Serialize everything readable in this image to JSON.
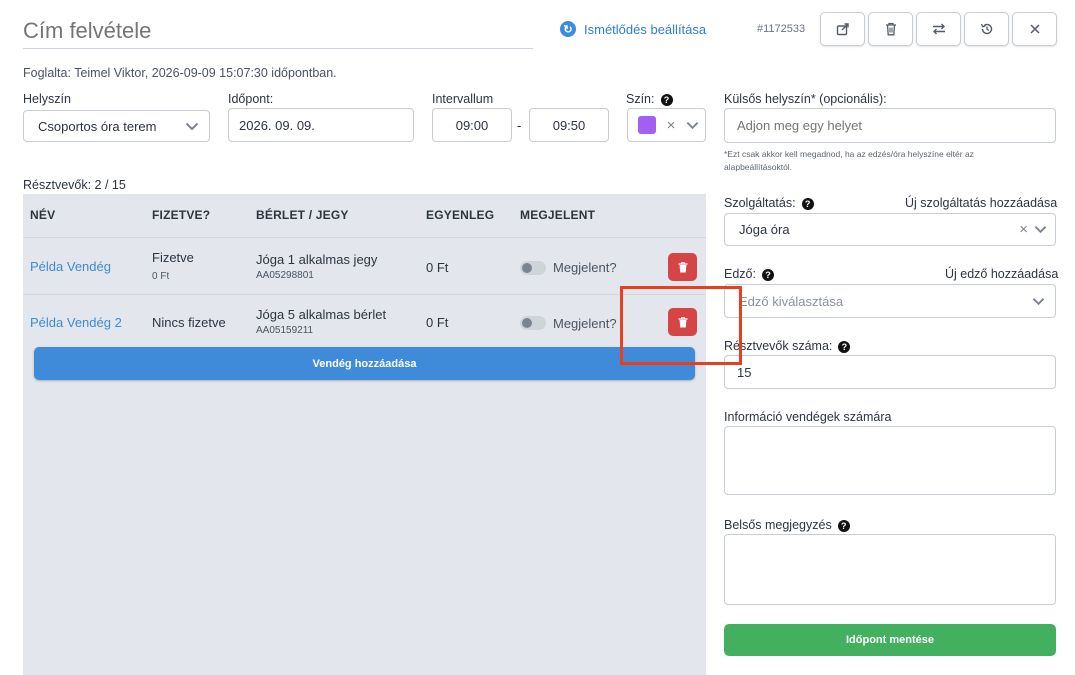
{
  "header": {
    "title_placeholder": "Cím felvétele",
    "repeat_label": "Ismétlődés beállítása",
    "booking_id": "#1172533"
  },
  "booked_by": "Foglalta: Teimel Viktor, 2026-09-09 15:07:30 időpontban.",
  "form": {
    "location_label": "Helyszín",
    "location_value": "Csoportos óra terem",
    "date_label": "Időpont:",
    "date_value": "2026. 09. 09.",
    "interval_label": "Intervallum",
    "interval_start": "09:00",
    "interval_separator": "-",
    "interval_end": "09:50",
    "color_label": "Szín:",
    "color_value": "#a55ff0"
  },
  "participants": {
    "count_label": "Résztvevők: 2 / 15",
    "headers": [
      "NÉV",
      "FIZETVE?",
      "BÉRLET / JEGY",
      "EGYENLEG",
      "MEGJELENT"
    ],
    "rows": [
      {
        "name": "Példa Vendég",
        "paid": "Fizetve",
        "paid_amount": "0 Ft",
        "pass": "Jóga 1 alkalmas jegy",
        "pass_code": "AA05298801",
        "balance": "0 Ft",
        "attended_label": "Megjelent?"
      },
      {
        "name": "Példa Vendég 2",
        "paid": "Nincs fizetve",
        "pass": "Jóga 5 alkalmas bérlet",
        "pass_code": "AA05159211",
        "balance": "0 Ft",
        "attended_label": "Megjelent?"
      }
    ],
    "add_guest_label": "Vendég hozzáadása"
  },
  "right": {
    "external_location_label": "Külsős helyszín* (opcionális):",
    "external_location_placeholder": "Adjon meg egy helyet",
    "external_hint": "*Ezt csak akkor kell megadnod, ha az edzés/óra helyszíne eltér az alapbeállításoktól.",
    "service_label": "Szolgáltatás:",
    "new_service_link": "Új szolgáltatás hozzáadása",
    "service_value": "Jóga óra",
    "trainer_label": "Edző:",
    "new_trainer_link": "Új edző hozzáadása",
    "trainer_placeholder": "Edző kiválasztása",
    "capacity_label": "Résztvevők száma:",
    "capacity_value": "15",
    "guest_info_label": "Információ vendégek számára",
    "internal_note_label": "Belsős megjegyzés",
    "save_label": "Időpont mentése"
  },
  "colors": {
    "accent_blue": "#3f8bd9",
    "delete_red": "#d64545",
    "save_green": "#43b05f",
    "highlight": "#e8401e"
  }
}
